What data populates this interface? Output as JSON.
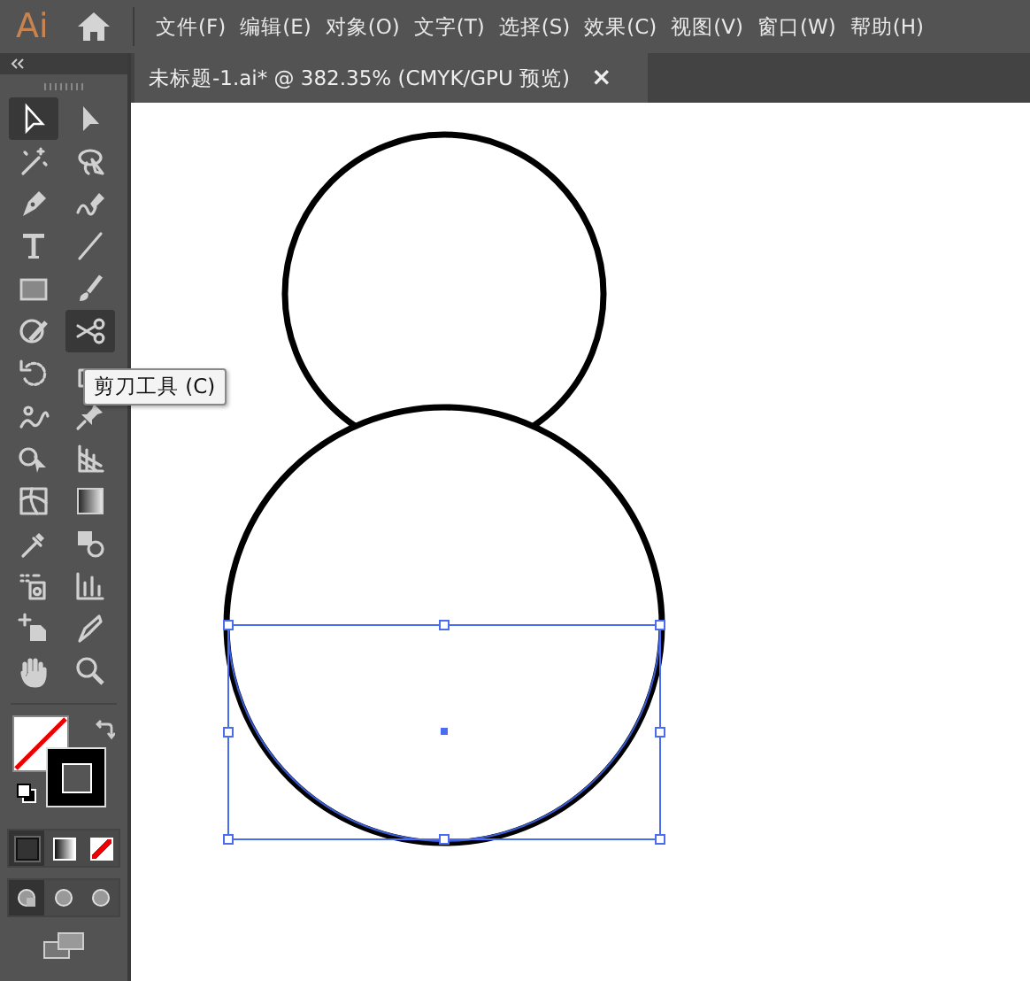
{
  "app": {
    "logo": "Ai"
  },
  "menu": [
    "文件(F)",
    "编辑(E)",
    "对象(O)",
    "文字(T)",
    "选择(S)",
    "效果(C)",
    "视图(V)",
    "窗口(W)",
    "帮助(H)"
  ],
  "tab": {
    "title": "未标题-1.ai* @ 382.35% (CMYK/GPU 预览)",
    "close": "×",
    "selected": true
  },
  "tools": [
    {
      "selected": true
    },
    {
      "selected": false
    },
    {
      "selected": false
    },
    {
      "selected": false
    },
    {
      "selected": false
    },
    {
      "selected": false
    },
    {
      "selected": false
    },
    {
      "selected": false
    },
    {
      "selected": false
    },
    {
      "selected": false
    },
    {
      "selected": false
    },
    {
      "selected": true
    },
    {
      "selected": false
    },
    {
      "selected": false
    },
    {
      "selected": false
    },
    {
      "selected": false
    },
    {
      "selected": false
    },
    {
      "selected": false
    },
    {
      "selected": false
    },
    {
      "selected": false
    },
    {
      "selected": false
    },
    {
      "selected": false
    },
    {
      "selected": false
    },
    {
      "selected": false
    },
    {
      "selected": false
    },
    {
      "selected": false
    },
    {
      "selected": false
    },
    {
      "selected": false
    }
  ],
  "tooltip": "剪刀工具 (C)",
  "draw_modes": [
    {
      "selected": true
    },
    {
      "selected": false
    },
    {
      "selected": false
    }
  ],
  "color_modes": [
    {
      "selected": true
    },
    {
      "selected": false
    },
    {
      "selected": false
    }
  ]
}
